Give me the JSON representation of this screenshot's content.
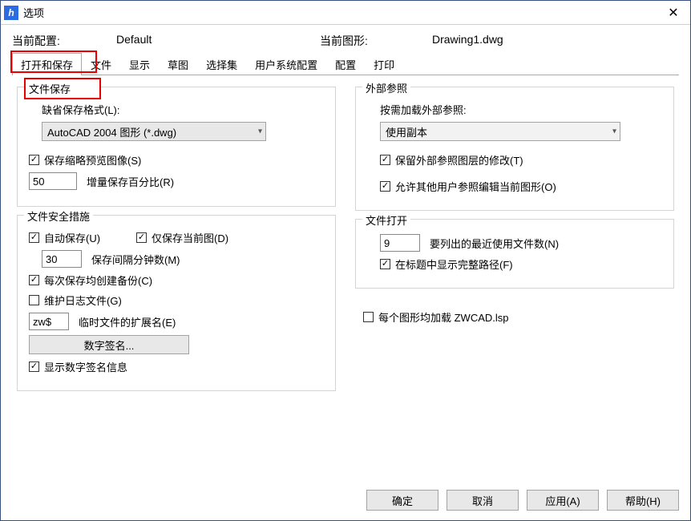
{
  "titlebar": {
    "icon_text": "h",
    "title": "选项",
    "close_glyph": "✕"
  },
  "config_row": {
    "current_config_label": "当前配置:",
    "current_config_value": "Default",
    "current_drawing_label": "当前图形:",
    "current_drawing_value": "Drawing1.dwg"
  },
  "tabs": [
    {
      "label": "打开和保存",
      "active": true
    },
    {
      "label": "文件"
    },
    {
      "label": "显示"
    },
    {
      "label": "草图"
    },
    {
      "label": "选择集"
    },
    {
      "label": "用户系统配置"
    },
    {
      "label": "配置"
    },
    {
      "label": "打印"
    }
  ],
  "file_save_group": {
    "title": "文件保存",
    "default_format_label": "缺省保存格式(L):",
    "default_format_value": "AutoCAD 2004 图形 (*.dwg)",
    "save_thumbnail": {
      "checked": true,
      "label": "保存缩略预览图像(S)"
    },
    "incremental_pct_value": "50",
    "incremental_pct_label": "增量保存百分比(R)"
  },
  "safety_group": {
    "title": "文件安全措施",
    "autosave": {
      "checked": true,
      "label": "自动保存(U)"
    },
    "save_current_only": {
      "checked": true,
      "label": "仅保存当前图(D)"
    },
    "interval_value": "30",
    "interval_label": "保存间隔分钟数(M)",
    "backup_each": {
      "checked": true,
      "label": "每次保存均创建备份(C)"
    },
    "maintain_log": {
      "checked": false,
      "label": "维护日志文件(G)"
    },
    "temp_ext_value": "zw$",
    "temp_ext_label": "临时文件的扩展名(E)",
    "digital_sig_btn": "数字签名...",
    "show_sig_info": {
      "checked": true,
      "label": "显示数字签名信息"
    }
  },
  "xref_group": {
    "title": "外部参照",
    "on_demand_label": "按需加载外部参照:",
    "on_demand_value": "使用副本",
    "retain_layers": {
      "checked": true,
      "label": "保留外部参照图层的修改(T)"
    },
    "allow_others": {
      "checked": true,
      "label": "允许其他用户参照编辑当前图形(O)"
    }
  },
  "file_open_group": {
    "title": "文件打开",
    "recent_count_value": "9",
    "recent_count_label": "要列出的最近使用文件数(N)",
    "show_full_path": {
      "checked": true,
      "label": "在标题中显示完整路径(F)"
    }
  },
  "load_lsp": {
    "checked": false,
    "label": "每个图形均加载 ZWCAD.lsp"
  },
  "footer": {
    "ok": "确定",
    "cancel": "取消",
    "apply": "应用(A)",
    "help": "帮助(H)"
  }
}
